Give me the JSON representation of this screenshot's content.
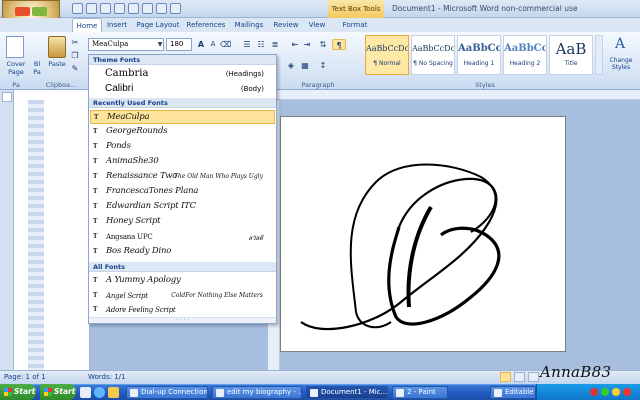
{
  "app": {
    "window_title": "Document1 - Microsoft Word non-commercial use",
    "context_tab_group": "Text Box Tools"
  },
  "tabs": [
    "Home",
    "Insert",
    "Page Layout",
    "References",
    "Mailings",
    "Review",
    "View",
    "Format"
  ],
  "ribbon": {
    "font_name": "MeaCulpa",
    "font_size": "180",
    "groups": {
      "pages": "Pa",
      "clipboard": "Clipboa...",
      "paragraph": "Paragraph",
      "styles": "Styles"
    },
    "cover_page_label": "Cover Page",
    "blank_label": "Bl Pa",
    "paste_label": "Paste",
    "styles": [
      {
        "preview": "AaBbCcDc",
        "name": "¶ Normal"
      },
      {
        "preview": "AaBbCcDc",
        "name": "¶ No Spacing"
      },
      {
        "preview": "AaBbCc",
        "name": "Heading 1"
      },
      {
        "preview": "AaBbCc",
        "name": "Heading 2"
      },
      {
        "preview": "AaB",
        "name": "Title"
      }
    ],
    "change_styles_label": "Change Styles"
  },
  "font_dropdown": {
    "theme_header": "Theme Fonts",
    "theme_fonts": [
      {
        "name": "Cambria",
        "tag": "(Headings)"
      },
      {
        "name": "Calibri",
        "tag": "(Body)"
      }
    ],
    "recent_header": "Recently Used Fonts",
    "recent_fonts": [
      {
        "name": "MeaCulpa",
        "preview": ""
      },
      {
        "name": "GeorgeRounds",
        "preview": ""
      },
      {
        "name": "Ponds",
        "preview": ""
      },
      {
        "name": "AnimaShe30",
        "preview": ""
      },
      {
        "name": "Renaissance Two",
        "preview": "The Old Man Who Plays Ugly"
      },
      {
        "name": "FrancescaTones Plana",
        "preview": ""
      },
      {
        "name": "Edwardian Script ITC",
        "preview": ""
      },
      {
        "name": "Honey Script",
        "preview": ""
      },
      {
        "name": "Angsana UPC",
        "preview": "สวัสดี"
      },
      {
        "name": "Bos Ready Dino",
        "preview": ""
      }
    ],
    "all_header": "All Fonts",
    "all_fonts": [
      {
        "name": "A Yummy Apology",
        "preview": ""
      },
      {
        "name": "Angel Script",
        "preview": "ColdFor Nothing Else Matters"
      },
      {
        "name": "Adore Feeling Script",
        "preview": ""
      }
    ]
  },
  "document": {
    "monogram_letter": "B"
  },
  "status_bar": {
    "page": "Page: 1 of 1",
    "words": "Words: 1/1"
  },
  "taskbar": {
    "start_label": "Start",
    "items": [
      {
        "label": "Dial-up Connection"
      },
      {
        "label": "edit my biography - ..."
      },
      {
        "label": "Document1 - Mic..."
      },
      {
        "label": "2 - Paint"
      },
      {
        "label": "Editable Monogram ..."
      }
    ]
  },
  "watermark": "AnnaB83",
  "colors": {
    "ribbon_text": "#15428b",
    "selection_highlight": "#fde49a",
    "taskbar_blue": "#245bc1",
    "start_green": "#3a9a35"
  }
}
